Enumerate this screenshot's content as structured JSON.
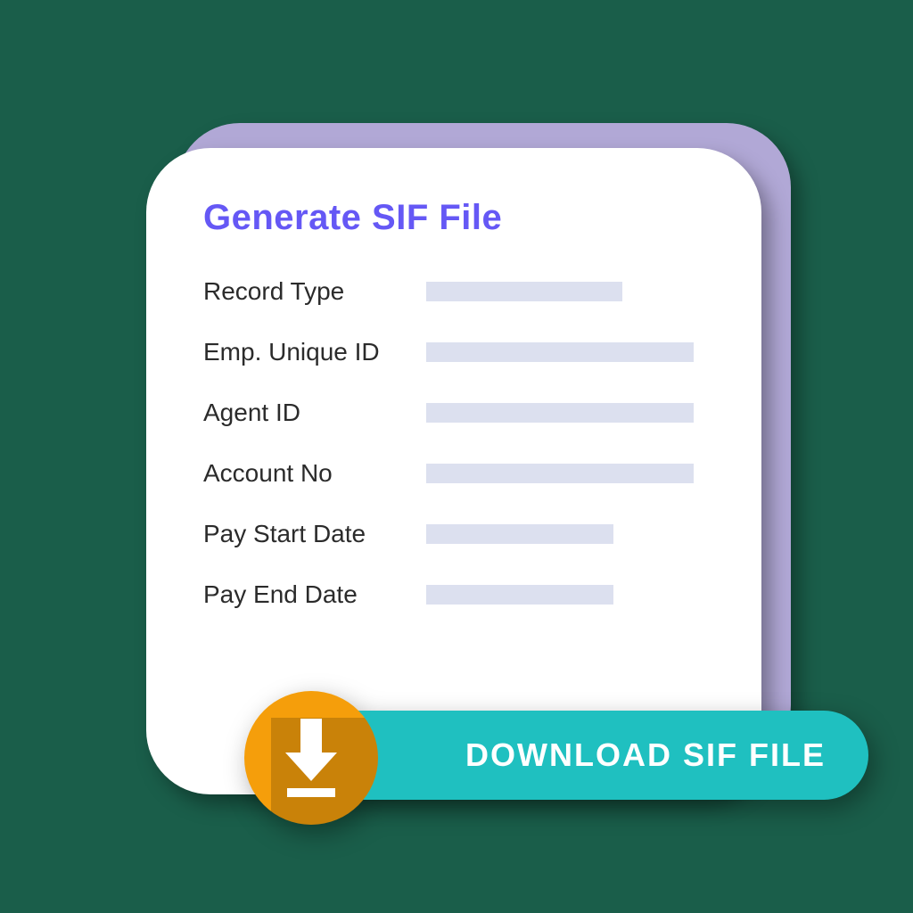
{
  "card": {
    "title": "Generate SIF File",
    "fields": [
      {
        "label": "Record Type",
        "bar": "short"
      },
      {
        "label": "Emp. Unique ID",
        "bar": "long"
      },
      {
        "label": "Agent ID",
        "bar": "long"
      },
      {
        "label": "Account No",
        "bar": "long"
      },
      {
        "label": "Pay Start Date",
        "bar": "med"
      },
      {
        "label": "Pay End Date",
        "bar": "med"
      }
    ]
  },
  "download": {
    "label": "DOWNLOAD SIF FILE"
  },
  "colors": {
    "bg": "#1a5e4a",
    "backCard": "#b1a8d6",
    "frontCard": "#ffffff",
    "title": "#6558f5",
    "bar": "#dce0ef",
    "pill": "#1fc0c0",
    "badge": "#f59e0b"
  }
}
